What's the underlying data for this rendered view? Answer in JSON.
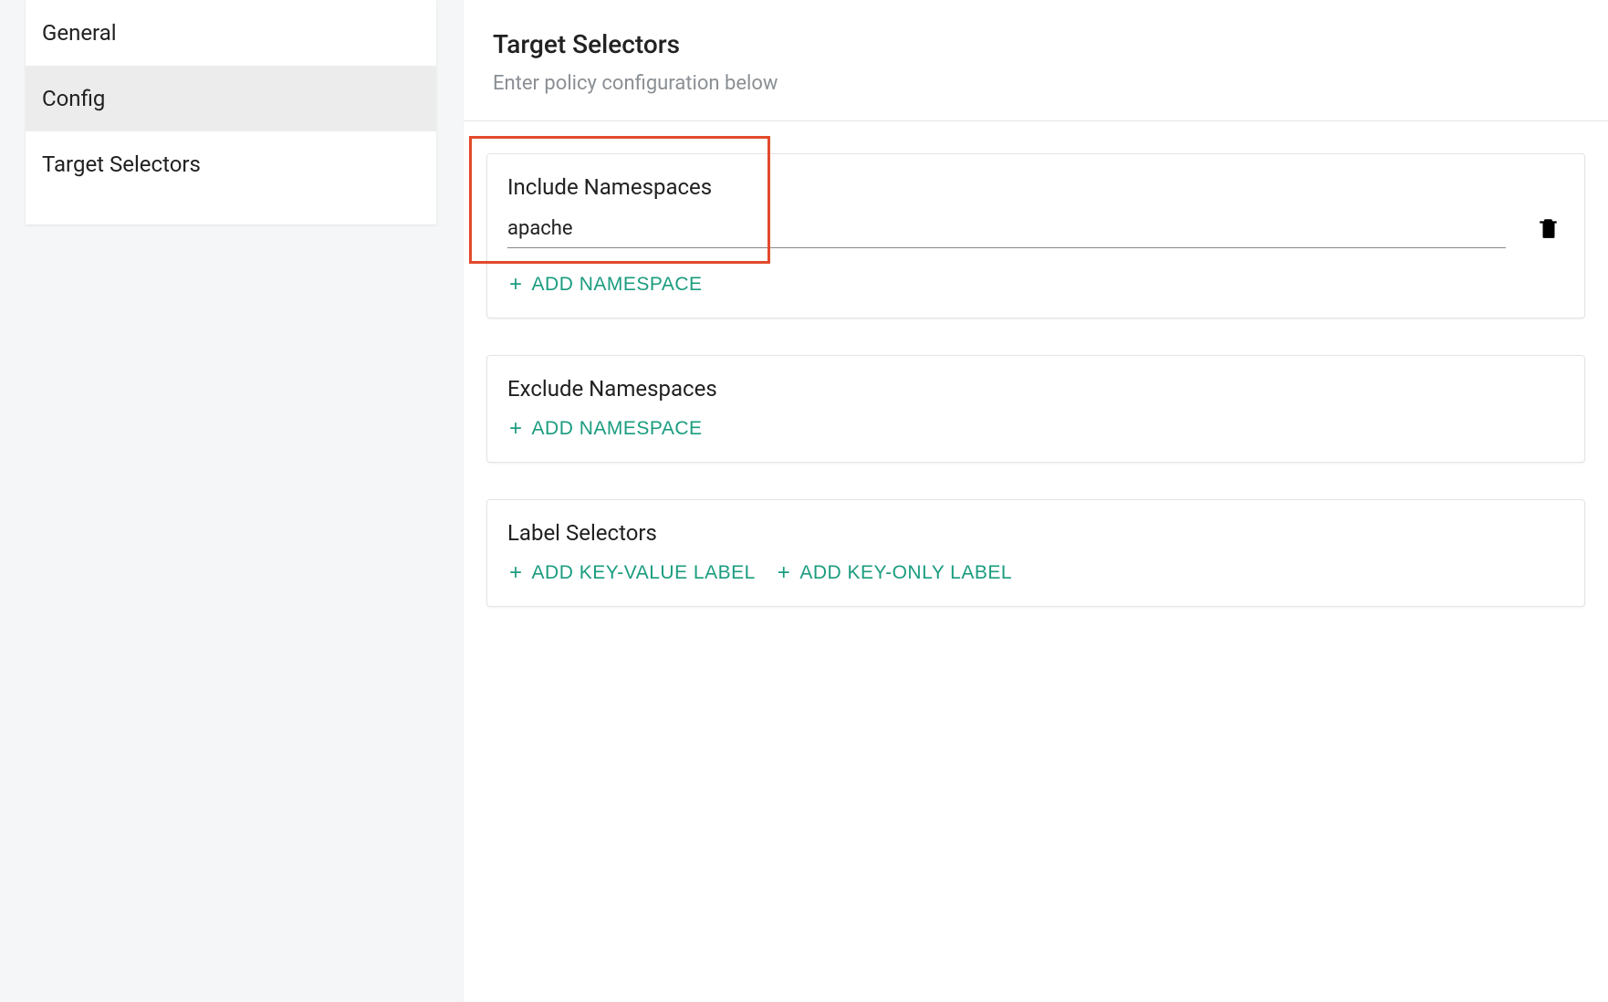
{
  "sidebar": {
    "items": [
      {
        "label": "General",
        "active": false
      },
      {
        "label": "Config",
        "active": true
      },
      {
        "label": "Target Selectors",
        "active": false
      }
    ]
  },
  "header": {
    "title": "Target Selectors",
    "subtitle": "Enter policy configuration below"
  },
  "cards": {
    "include_namespaces": {
      "title": "Include Namespaces",
      "entries": [
        {
          "value": "apache"
        }
      ],
      "add_label": "ADD  NAMESPACE"
    },
    "exclude_namespaces": {
      "title": "Exclude Namespaces",
      "add_label": "ADD  NAMESPACE"
    },
    "label_selectors": {
      "title": "Label Selectors",
      "add_kv_label": "ADD KEY-VALUE LABEL",
      "add_ko_label": "ADD KEY-ONLY LABEL"
    }
  },
  "icons": {
    "plus": "+"
  }
}
